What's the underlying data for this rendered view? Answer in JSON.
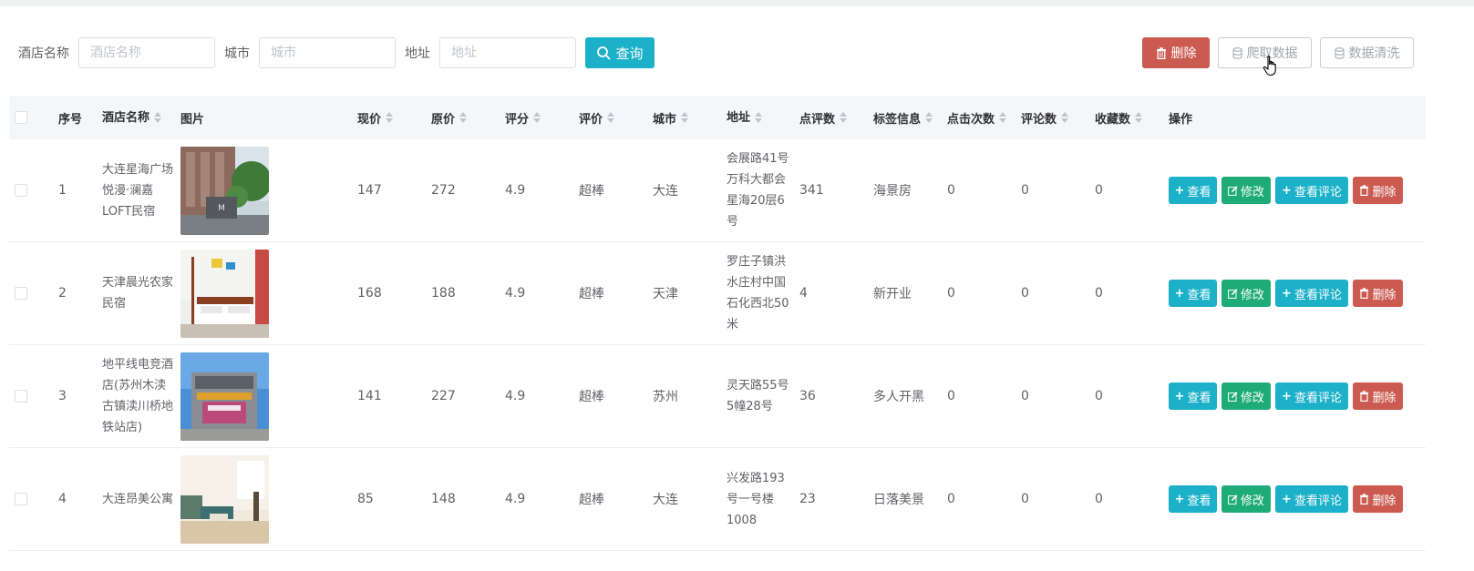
{
  "search": {
    "hotel_name_label": "酒店名称",
    "hotel_name_placeholder": "酒店名称",
    "city_label": "城市",
    "city_placeholder": "城市",
    "address_label": "地址",
    "address_placeholder": "地址",
    "query_label": "查询"
  },
  "toolbar": {
    "delete_label": "删除",
    "crawl_label": "爬取数据",
    "clean_label": "数据清洗"
  },
  "colors": {
    "primary": "#1cb0c9",
    "success": "#1fab78",
    "danger": "#cb5b50"
  },
  "table": {
    "headers": {
      "index": "序号",
      "name": "酒店名称",
      "image": "图片",
      "price_now": "现价",
      "price_orig": "原价",
      "score": "评分",
      "rating": "评价",
      "city": "城市",
      "address": "地址",
      "review_count": "点评数",
      "tags": "标签信息",
      "clicks": "点击次数",
      "comments": "评论数",
      "favorites": "收藏数",
      "ops": "操作"
    },
    "ops": {
      "view": "查看",
      "edit": "修改",
      "view_reviews": "查看评论",
      "delete": "删除"
    },
    "rows": [
      {
        "index": "1",
        "name": "大连星海广场悦漫·澜嘉LOFT民宿",
        "price_now": "147",
        "price_orig": "272",
        "score": "4.9",
        "rating": "超棒",
        "city": "大连",
        "address": "会展路41号万科大都会星海20层6号",
        "review_count": "341",
        "tags": "海景房",
        "clicks": "0",
        "comments": "0",
        "favorites": "0"
      },
      {
        "index": "2",
        "name": "天津晨光农家民宿",
        "price_now": "168",
        "price_orig": "188",
        "score": "4.9",
        "rating": "超棒",
        "city": "天津",
        "address": "罗庄子镇洪水庄村中国石化西北50米",
        "review_count": "4",
        "tags": "新开业",
        "clicks": "0",
        "comments": "0",
        "favorites": "0"
      },
      {
        "index": "3",
        "name": "地平线电竞酒店(苏州木渎古镇渎川桥地铁站店)",
        "price_now": "141",
        "price_orig": "227",
        "score": "4.9",
        "rating": "超棒",
        "city": "苏州",
        "address": "灵天路55号5幢28号",
        "review_count": "36",
        "tags": "多人开黑",
        "clicks": "0",
        "comments": "0",
        "favorites": "0"
      },
      {
        "index": "4",
        "name": "大连昂美公寓",
        "price_now": "85",
        "price_orig": "148",
        "score": "4.9",
        "rating": "超棒",
        "city": "大连",
        "address": "兴发路193号一号楼1008",
        "review_count": "23",
        "tags": "日落美景",
        "clicks": "0",
        "comments": "0",
        "favorites": "0"
      }
    ]
  }
}
